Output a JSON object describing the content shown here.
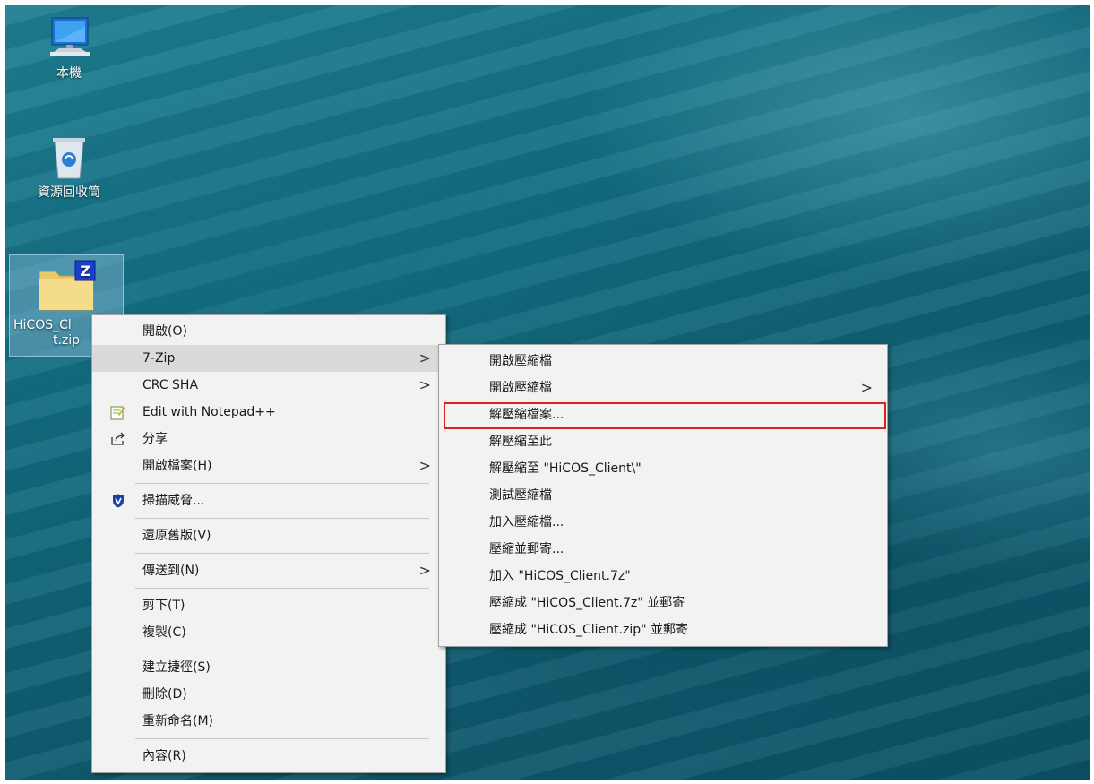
{
  "desktop": {
    "icons": [
      {
        "label": "本機",
        "icon": "computer-icon"
      },
      {
        "label": "資源回收筒",
        "icon": "recycle-bin-icon"
      },
      {
        "label_line1": "HiCOS_Cl",
        "label_line2": "t.zip",
        "icon": "zip-folder-icon"
      }
    ]
  },
  "context_menu": {
    "items": [
      {
        "label": "開啟(O)"
      },
      {
        "label": "7-Zip",
        "submenu": true
      },
      {
        "label": "CRC SHA",
        "submenu": true
      },
      {
        "label": "Edit with Notepad++",
        "icon": "notepad-plus-plus-icon"
      },
      {
        "label": "分享",
        "icon": "share-icon"
      },
      {
        "label": "開啟檔案(H)",
        "submenu": true
      },
      {
        "label": "掃描威脅...",
        "icon": "defender-shield-icon"
      },
      {
        "label": "還原舊版(V)"
      },
      {
        "label": "傳送到(N)",
        "submenu": true
      },
      {
        "label": "剪下(T)"
      },
      {
        "label": "複製(C)"
      },
      {
        "label": "建立捷徑(S)"
      },
      {
        "label": "刪除(D)"
      },
      {
        "label": "重新命名(M)"
      },
      {
        "label": "內容(R)"
      }
    ]
  },
  "sevenzip_submenu": {
    "items": [
      {
        "label": "開啟壓縮檔"
      },
      {
        "label": "開啟壓縮檔",
        "submenu": true
      },
      {
        "label": "解壓縮檔案...",
        "highlighted": true
      },
      {
        "label": "解壓縮至此"
      },
      {
        "label": "解壓縮至 \"HiCOS_Client\\\""
      },
      {
        "label": "測試壓縮檔"
      },
      {
        "label": "加入壓縮檔..."
      },
      {
        "label": "壓縮並郵寄..."
      },
      {
        "label": "加入 \"HiCOS_Client.7z\""
      },
      {
        "label": "壓縮成 \"HiCOS_Client.7z\" 並郵寄"
      },
      {
        "label": "壓縮成 \"HiCOS_Client.zip\" 並郵寄"
      }
    ]
  },
  "colors": {
    "highlight_box": "#e02020",
    "menu_bg": "#f2f2f2",
    "hover_bg": "#dadada"
  }
}
